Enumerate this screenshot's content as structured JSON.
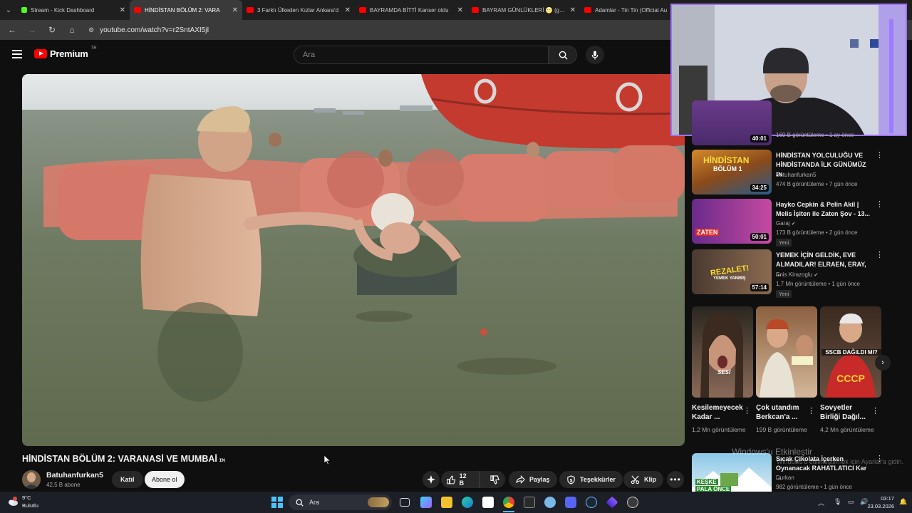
{
  "browser": {
    "tabs": [
      {
        "title": "Stream - Kick Dashboard",
        "favicon": "kick-icon",
        "active": false
      },
      {
        "title": "HİNDİSTAN BÖLÜM 2: VARA",
        "favicon": "youtube-icon",
        "active": true
      },
      {
        "title": "3 Farklı Ülkeden Kızlar Ankara'd",
        "favicon": "youtube-icon",
        "active": false
      },
      {
        "title": "BAYRAMDA BİTTİ Kanser oldu",
        "favicon": "youtube-icon",
        "active": false
      },
      {
        "title": "BAYRAM GÜNLÜKLERİ 🌝 (go k",
        "favicon": "youtube-icon",
        "active": false
      },
      {
        "title": "Adamlar - Tin Tin (Official Au",
        "favicon": "youtube-icon",
        "active": false
      }
    ],
    "url": "youtube.com/watch?v=r2SntAXI5jI"
  },
  "header": {
    "logo_text": "Premium",
    "region": "TR",
    "search_placeholder": "Ara"
  },
  "video": {
    "title": "HİNDİSTAN BÖLÜM 2: VARANASİ VE MUMBAİ",
    "tier_badge": "ɪɴ",
    "channel_name": "Batuhanfurkan5",
    "subscribers": "42,5 B abone",
    "join_label": "Katıl",
    "subscribe_label": "Abone ol",
    "likes": "12 B",
    "share_label": "Paylaş",
    "thanks_label": "Teşekkürler",
    "clip_label": "Klip"
  },
  "recommendations": [
    {
      "title": "",
      "channel": "",
      "meta": "169 B görüntüleme • 1 ay önce",
      "duration": "40:01",
      "new": ""
    },
    {
      "title": "HİNDİSTAN YOLCULUĞU VE HİNDİSTANDA İLK GÜNÜMÜZ ɪɴ",
      "channel": "Batuhanfurkan5",
      "meta": "474 B görüntüleme • 7 gün önce",
      "duration": "34:25",
      "new": ""
    },
    {
      "title": "Hayko Cepkin & Pelin Akil | Melis İşiten ile Zaten Şov - 13...",
      "channel": "Garaj",
      "meta": "173 B görüntüleme • 2 gün önce",
      "duration": "50:01",
      "new": "Yeni"
    },
    {
      "title": "YEMEK İÇİN GELDİK, EVE ALMADILAR! ELRAEN, ERAY, ...",
      "channel": "Enis Kirazoglu",
      "meta": "1,7 Mn görüntüleme • 1 gün önce",
      "duration": "57:14",
      "new": "Yeni"
    },
    {
      "title": "Sıcak Çikolata İçerken Oynanacak RAHATLATICI Kar ...",
      "channel": "Durkan",
      "meta": "982 görüntüleme • 1 gün önce",
      "duration": "",
      "new": ""
    }
  ],
  "thumb_text": {
    "bolum": "HİNDİSTAN",
    "bolum_sub": "BÖLÜM 1",
    "zaten": "ZATEN",
    "rezalet": "REZALET!",
    "yemek": "YEMEK YANMIŞ",
    "keske": "KEŞKE",
    "keske2": "PALA ÖNCE"
  },
  "shorts": [
    {
      "title": "Kesilemeyecek Kadar ...",
      "views": "1,2 Mn görüntüleme",
      "overlay": "SESİ"
    },
    {
      "title": "Çok utandım Berkcan'a ...",
      "views": "199 B görüntüleme",
      "overlay": ""
    },
    {
      "title": "Sovyetler Birliği Dağıl...",
      "views": "4,2 Mn görüntüleme",
      "overlay": "SSCB DAĞILDI MI?"
    }
  ],
  "windows_watermark": {
    "line1": "Windows'u Etkinleştir",
    "line2": "Windows'u etkinleştirmek için Ayarlar'a gidin."
  },
  "taskbar": {
    "temperature": "9°C",
    "weather_desc": "Bulutlu",
    "search_label": "Ara",
    "time": "03:17",
    "date": "23.03.2026"
  }
}
